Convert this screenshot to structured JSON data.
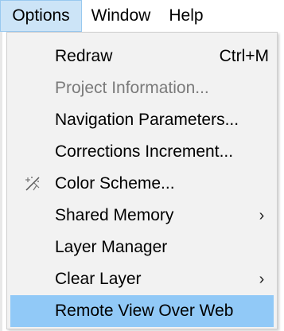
{
  "menubar": {
    "items": [
      {
        "label": "Options"
      },
      {
        "label": "Window"
      },
      {
        "label": "Help"
      }
    ]
  },
  "menu": {
    "items": [
      {
        "label": "Redraw",
        "shortcut": "Ctrl+M"
      },
      {
        "label": "Project Information..."
      },
      {
        "label": "Navigation Parameters..."
      },
      {
        "label": "Corrections Increment..."
      },
      {
        "label": "Color Scheme...",
        "icon": "color-scheme-icon"
      },
      {
        "label": "Shared Memory"
      },
      {
        "label": "Layer Manager"
      },
      {
        "label": "Clear Layer"
      },
      {
        "label": "Remote View Over Web"
      }
    ]
  },
  "colors": {
    "menubar_active_bg": "#cce4f7",
    "menu_bg": "#f2f2f2",
    "highlight_bg": "#91c9f7",
    "disabled_text": "#7a7a7a"
  }
}
